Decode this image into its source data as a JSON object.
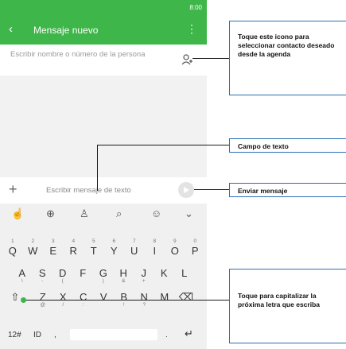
{
  "status": {
    "text": "8:00"
  },
  "appbar": {
    "back_icon": "back-arrow-icon",
    "title": "Mensaje nuevo",
    "more_icon": "more-vert-icon"
  },
  "recipient": {
    "placeholder": "Escribir nombre o número de la persona"
  },
  "compose": {
    "placeholder": "Escribir mensaje de texto"
  },
  "keyboard": {
    "toolbar": [
      "gesture-icon",
      "globe-icon",
      "shirt-icon",
      "search-icon",
      "emoji-icon",
      "chevron-down-icon"
    ],
    "row1": [
      {
        "k": "Q",
        "h": "1"
      },
      {
        "k": "W",
        "h": "2"
      },
      {
        "k": "E",
        "h": "3"
      },
      {
        "k": "R",
        "h": "4"
      },
      {
        "k": "T",
        "h": "5"
      },
      {
        "k": "Y",
        "h": "6"
      },
      {
        "k": "U",
        "h": "7"
      },
      {
        "k": "I",
        "h": "8"
      },
      {
        "k": "O",
        "h": "9"
      },
      {
        "k": "P",
        "h": "0"
      }
    ],
    "row2": [
      {
        "k": "A",
        "s": "\\"
      },
      {
        "k": "S",
        "s": "-"
      },
      {
        "k": "D",
        "s": "("
      },
      {
        "k": "F",
        "s": ""
      },
      {
        "k": "G",
        "s": ")"
      },
      {
        "k": "H",
        "s": "&"
      },
      {
        "k": "J",
        "s": "+"
      },
      {
        "k": "K",
        "s": ""
      },
      {
        "k": "L",
        "s": ""
      }
    ],
    "row3": [
      {
        "k": "Z",
        "s": "@"
      },
      {
        "k": "X",
        "s": "/"
      },
      {
        "k": "C",
        "s": ":"
      },
      {
        "k": "V",
        "s": ""
      },
      {
        "k": "B",
        "s": "!"
      },
      {
        "k": "N",
        "s": "?"
      },
      {
        "k": "M",
        "s": ""
      }
    ],
    "bottom": {
      "num": "12#",
      "lang": "ID",
      "comma": ",",
      "period": "."
    }
  },
  "callouts": {
    "contact": "Toque este icono para seleccionar contacto deseado desde la agenda",
    "textfield": "Campo de texto",
    "send": "Enviar mensaje",
    "shift": "Toque para capitalizar la próxima letra que escriba"
  },
  "colors": {
    "appbar": "#3fb649",
    "callout_border": "#2a6fb5"
  }
}
